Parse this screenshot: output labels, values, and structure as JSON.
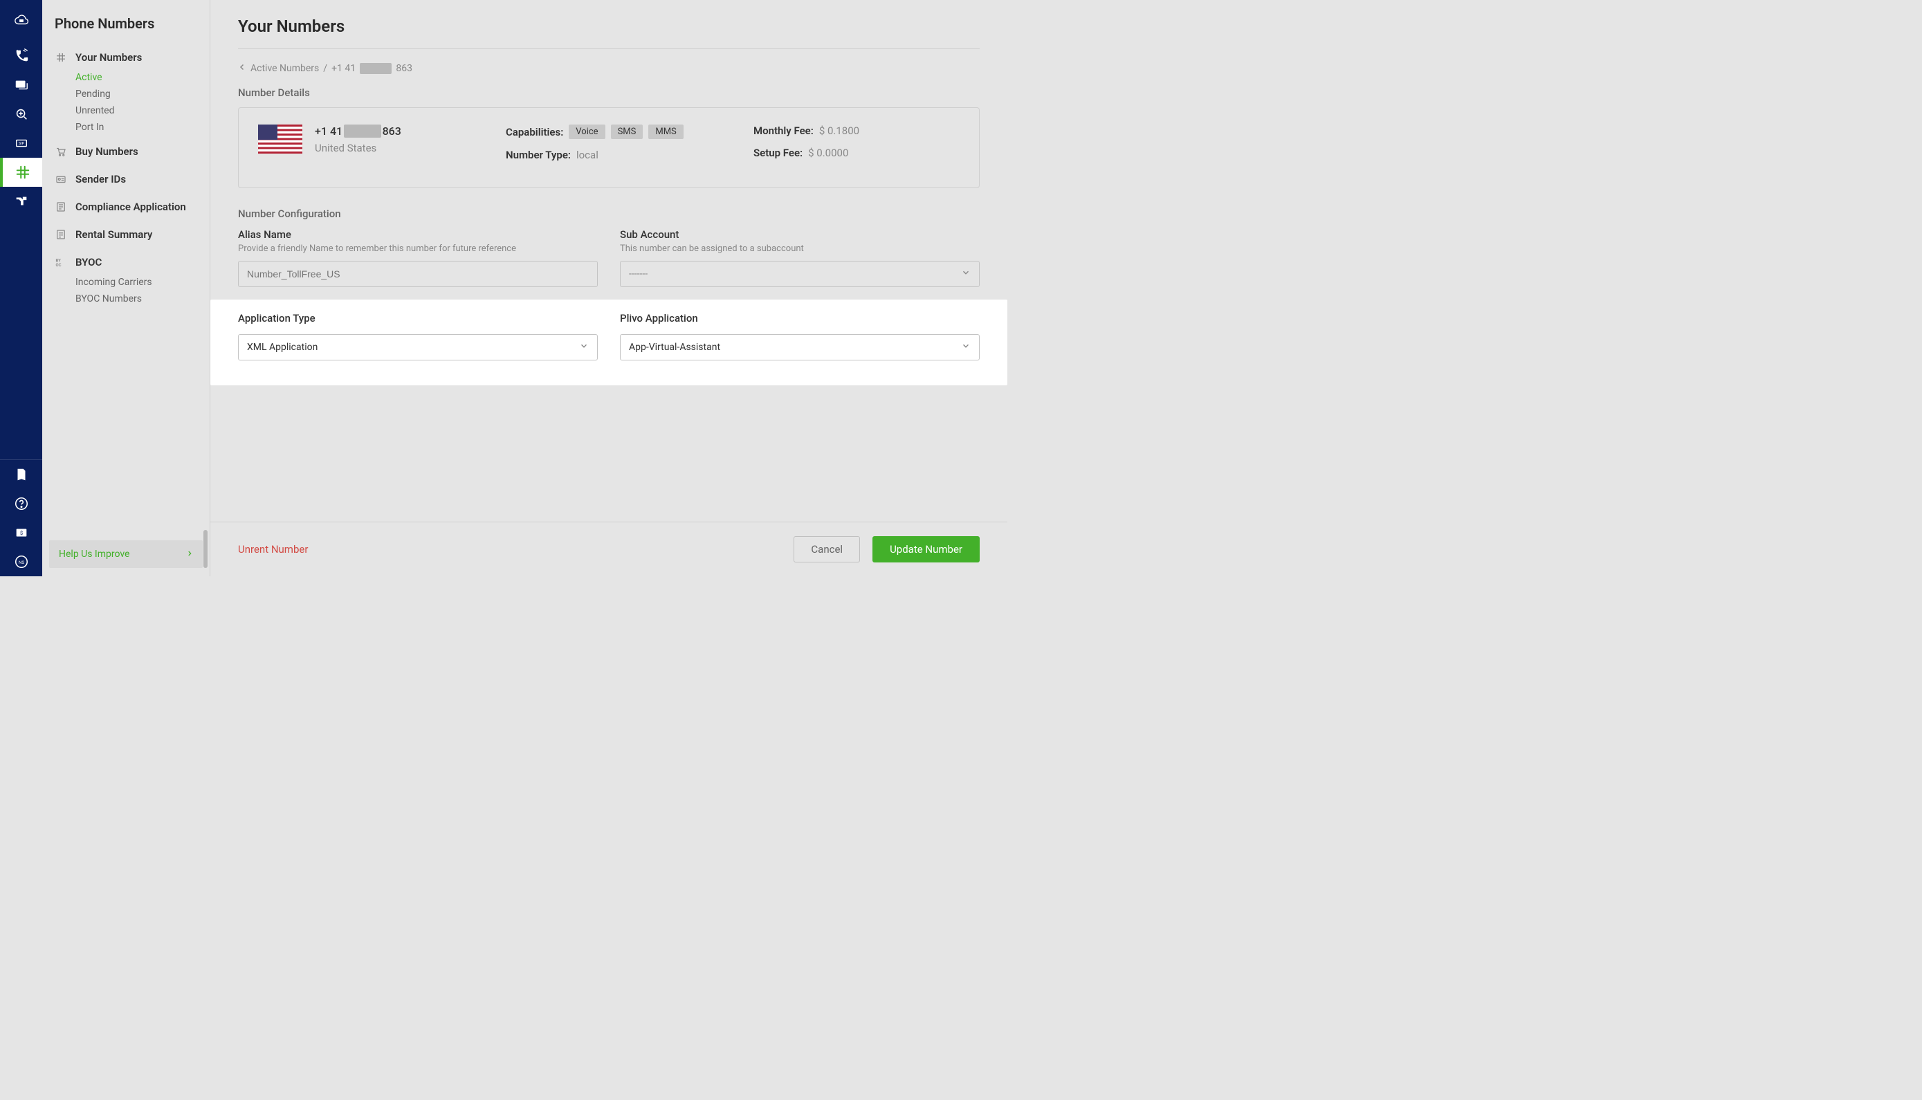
{
  "sidebar": {
    "title": "Phone Numbers",
    "groups": [
      {
        "label": "Your Numbers",
        "children": [
          "Active",
          "Pending",
          "Unrented",
          "Port In"
        ],
        "active_child": 0
      },
      {
        "label": "Buy Numbers",
        "children": []
      },
      {
        "label": "Sender IDs",
        "children": []
      },
      {
        "label": "Compliance Application",
        "children": []
      },
      {
        "label": "Rental Summary",
        "children": []
      },
      {
        "label": "BYOC",
        "children": [
          "Incoming Carriers",
          "BYOC Numbers"
        ]
      }
    ],
    "help_label": "Help Us Improve"
  },
  "page": {
    "title": "Your Numbers",
    "breadcrumb": {
      "back": "Active Numbers",
      "current_prefix": "+1 41",
      "current_suffix": "863"
    },
    "details_heading": "Number Details",
    "phone": {
      "prefix": "+1 41",
      "suffix": "863",
      "country": "United States"
    },
    "capabilities_label": "Capabilities:",
    "capabilities": [
      "Voice",
      "SMS",
      "MMS"
    ],
    "number_type_label": "Number Type:",
    "number_type_value": "local",
    "monthly_fee_label": "Monthly Fee:",
    "monthly_fee_value": "$ 0.1800",
    "setup_fee_label": "Setup Fee:",
    "setup_fee_value": "$ 0.0000",
    "config_heading": "Number Configuration",
    "alias": {
      "label": "Alias Name",
      "help": "Provide a friendly Name to remember this number for future reference",
      "placeholder": "Number_TollFree_US"
    },
    "subaccount": {
      "label": "Sub Account",
      "help": "This number can be assigned to a subaccount",
      "value": "-------"
    },
    "app_type": {
      "label": "Application Type",
      "value": "XML Application"
    },
    "plivo_app": {
      "label": "Plivo Application",
      "value": "App-Virtual-Assistant"
    }
  },
  "footer": {
    "unrent": "Unrent Number",
    "cancel": "Cancel",
    "update": "Update Number"
  }
}
